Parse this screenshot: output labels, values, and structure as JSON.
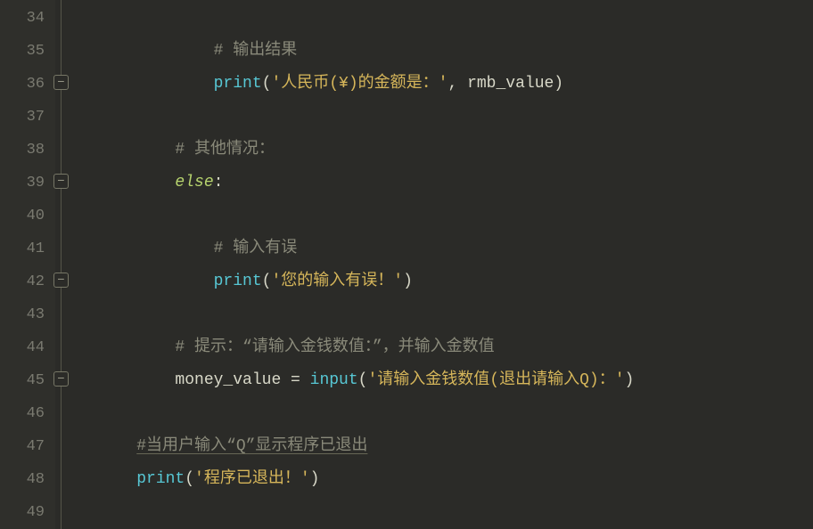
{
  "line_numbers": [
    "34",
    "35",
    "36",
    "37",
    "38",
    "39",
    "40",
    "41",
    "42",
    "43",
    "44",
    "45",
    "46",
    "47",
    "48",
    "49"
  ],
  "lines": {
    "35": {
      "indent": "            ",
      "comment": "# 输出结果"
    },
    "36": {
      "indent": "            ",
      "func": "print",
      "open": "(",
      "str": "'人民币(¥)的金额是：'",
      "comma": ", ",
      "var": "rmb_value",
      "close": ")"
    },
    "38": {
      "indent": "        ",
      "comment": "# 其他情况："
    },
    "39": {
      "indent": "        ",
      "kw": "else",
      "colon": ":"
    },
    "41": {
      "indent": "            ",
      "comment": "# 输入有误"
    },
    "42": {
      "indent": "            ",
      "func": "print",
      "open": "(",
      "str": "'您的输入有误！'",
      "close": ")"
    },
    "44": {
      "indent": "        ",
      "comment": "# 提示：“请输入金钱数值：”，并输入金数值"
    },
    "45": {
      "indent": "        ",
      "var": "money_value",
      "eq": " = ",
      "func": "input",
      "open": "(",
      "str": "'请输入金钱数值(退出请输入Q)：'",
      "close": ")"
    },
    "47": {
      "indent": "    ",
      "comment": "#当用户输入“Q”显示程序已退出"
    },
    "48": {
      "indent": "    ",
      "func": "print",
      "open": "(",
      "str": "'程序已退出！'",
      "close": ")"
    }
  }
}
